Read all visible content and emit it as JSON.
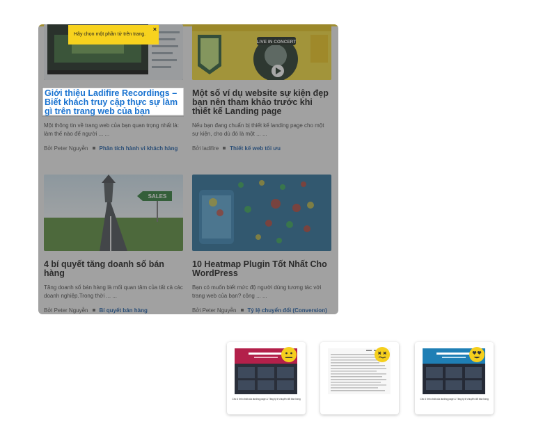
{
  "tooltip": {
    "text": "Hãy chọn một phần tử trên trang.",
    "close": "×"
  },
  "thumb_labels": {
    "concert": "LIVE IN CONCERT",
    "sales": "SALES"
  },
  "cards": [
    {
      "title": "Giới thiệu Ladifire Recordings – Biết khách truy cập thực sự làm gì trên trang web của bạn",
      "excerpt": "Một thông tin về trang web của bạn quan trọng nhất là: làm thế nào để người ... ...",
      "author": "Bởi Peter Nguyễn",
      "category": "Phân tích hành vi khách hàng"
    },
    {
      "title": "Một số ví dụ website sự kiện đẹp bạn nên tham khảo trước khi thiết kế Landing page",
      "excerpt": "Nếu bạn đang chuẩn bị thiết kế landing page cho một sự kiện, cho dù đó là một ... ...",
      "author": "Bởi ladifire",
      "category": "Thiết kế web tối ưu"
    },
    {
      "title": "4 bí quyết tăng doanh số bán hàng",
      "excerpt": "Tăng doanh số bán hàng là mối quan tâm của tất cả các doanh nghiệp.Trong thời ... ...",
      "author": "Bởi Peter Nguyễn",
      "category": "Bí quyết bán hàng"
    },
    {
      "title": "10 Heatmap Plugin Tốt Nhất Cho WordPress",
      "excerpt": "Bạn có muốn biết mức độ người dùng tương tác với trang web của bạn? công ... ...",
      "author": "Bởi Peter Nguyễn",
      "category": "Tỷ lệ chuyển đổi (Conversion)"
    }
  ],
  "options": [
    {
      "caption": "Cho 4 tính chất của landing page & Tăng tỷ lệ chuyển đổi bán hàng",
      "mood": "neutral"
    },
    {
      "caption": "",
      "mood": "dizzy"
    },
    {
      "caption": "Cho 4 tính chất của landing page & Tăng tỷ lệ chuyển đổi bán hàng",
      "mood": "love"
    }
  ],
  "colors": {
    "accent": "#f7d21e",
    "link": "#1f5fa8",
    "highlight_text": "#1a73d0"
  }
}
